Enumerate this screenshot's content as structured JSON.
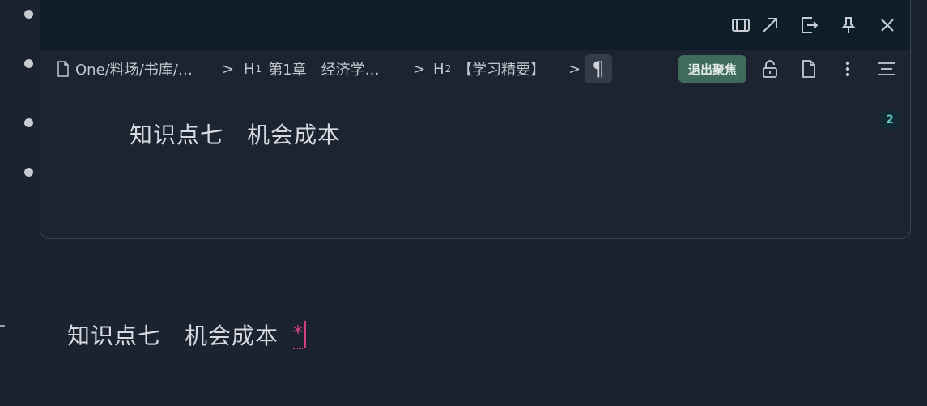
{
  "popover": {
    "breadcrumb": [
      {
        "label": "One/料场/书库/…"
      },
      {
        "prefix": "H",
        "level": "1",
        "label": "第1章　经济学…"
      },
      {
        "prefix": "H",
        "level": "2",
        "label": "【学习精要】"
      }
    ],
    "separator": ">",
    "pilcrow": "¶",
    "exit_focus_label": "退出聚焦",
    "heading": "知识点七　机会成本",
    "count_badge": "2",
    "header_icons": [
      "panel-icon",
      "open-external-icon",
      "export-icon",
      "pin-icon",
      "close-icon"
    ],
    "toolbar_icons": [
      "unlock-icon",
      "document-icon",
      "more-vertical-icon",
      "outline-icon"
    ]
  },
  "editor": {
    "heading": "知识点七　机会成本",
    "asterisk": "*"
  },
  "colors": {
    "background": "#1b2330",
    "popover_header": "#0e1e29",
    "accent_green": "#3f6b5b",
    "cursor_pink": "#d6407a",
    "badge_teal": "#66c8c9"
  }
}
